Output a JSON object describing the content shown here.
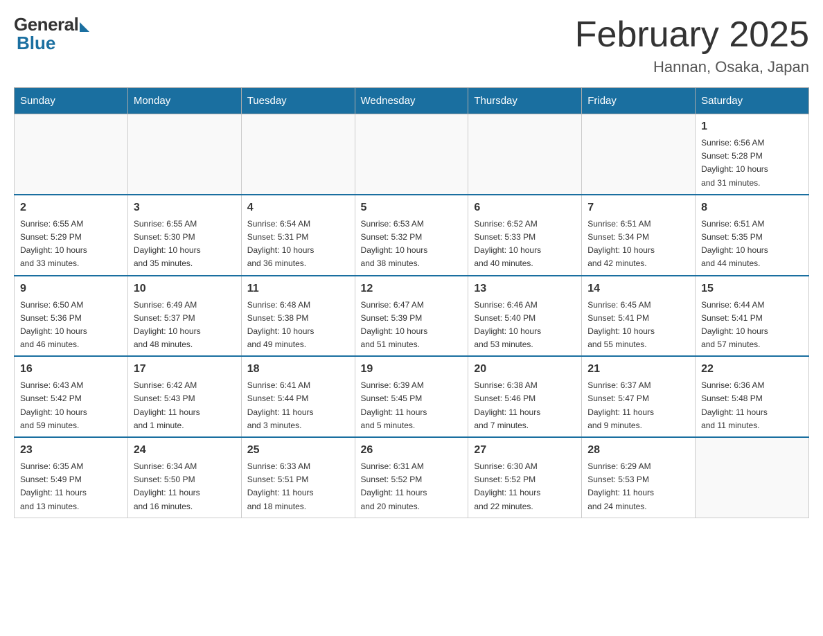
{
  "logo": {
    "general": "General",
    "blue": "Blue"
  },
  "title": {
    "month": "February 2025",
    "location": "Hannan, Osaka, Japan"
  },
  "weekdays": [
    "Sunday",
    "Monday",
    "Tuesday",
    "Wednesday",
    "Thursday",
    "Friday",
    "Saturday"
  ],
  "weeks": [
    [
      {
        "day": "",
        "info": ""
      },
      {
        "day": "",
        "info": ""
      },
      {
        "day": "",
        "info": ""
      },
      {
        "day": "",
        "info": ""
      },
      {
        "day": "",
        "info": ""
      },
      {
        "day": "",
        "info": ""
      },
      {
        "day": "1",
        "info": "Sunrise: 6:56 AM\nSunset: 5:28 PM\nDaylight: 10 hours\nand 31 minutes."
      }
    ],
    [
      {
        "day": "2",
        "info": "Sunrise: 6:55 AM\nSunset: 5:29 PM\nDaylight: 10 hours\nand 33 minutes."
      },
      {
        "day": "3",
        "info": "Sunrise: 6:55 AM\nSunset: 5:30 PM\nDaylight: 10 hours\nand 35 minutes."
      },
      {
        "day": "4",
        "info": "Sunrise: 6:54 AM\nSunset: 5:31 PM\nDaylight: 10 hours\nand 36 minutes."
      },
      {
        "day": "5",
        "info": "Sunrise: 6:53 AM\nSunset: 5:32 PM\nDaylight: 10 hours\nand 38 minutes."
      },
      {
        "day": "6",
        "info": "Sunrise: 6:52 AM\nSunset: 5:33 PM\nDaylight: 10 hours\nand 40 minutes."
      },
      {
        "day": "7",
        "info": "Sunrise: 6:51 AM\nSunset: 5:34 PM\nDaylight: 10 hours\nand 42 minutes."
      },
      {
        "day": "8",
        "info": "Sunrise: 6:51 AM\nSunset: 5:35 PM\nDaylight: 10 hours\nand 44 minutes."
      }
    ],
    [
      {
        "day": "9",
        "info": "Sunrise: 6:50 AM\nSunset: 5:36 PM\nDaylight: 10 hours\nand 46 minutes."
      },
      {
        "day": "10",
        "info": "Sunrise: 6:49 AM\nSunset: 5:37 PM\nDaylight: 10 hours\nand 48 minutes."
      },
      {
        "day": "11",
        "info": "Sunrise: 6:48 AM\nSunset: 5:38 PM\nDaylight: 10 hours\nand 49 minutes."
      },
      {
        "day": "12",
        "info": "Sunrise: 6:47 AM\nSunset: 5:39 PM\nDaylight: 10 hours\nand 51 minutes."
      },
      {
        "day": "13",
        "info": "Sunrise: 6:46 AM\nSunset: 5:40 PM\nDaylight: 10 hours\nand 53 minutes."
      },
      {
        "day": "14",
        "info": "Sunrise: 6:45 AM\nSunset: 5:41 PM\nDaylight: 10 hours\nand 55 minutes."
      },
      {
        "day": "15",
        "info": "Sunrise: 6:44 AM\nSunset: 5:41 PM\nDaylight: 10 hours\nand 57 minutes."
      }
    ],
    [
      {
        "day": "16",
        "info": "Sunrise: 6:43 AM\nSunset: 5:42 PM\nDaylight: 10 hours\nand 59 minutes."
      },
      {
        "day": "17",
        "info": "Sunrise: 6:42 AM\nSunset: 5:43 PM\nDaylight: 11 hours\nand 1 minute."
      },
      {
        "day": "18",
        "info": "Sunrise: 6:41 AM\nSunset: 5:44 PM\nDaylight: 11 hours\nand 3 minutes."
      },
      {
        "day": "19",
        "info": "Sunrise: 6:39 AM\nSunset: 5:45 PM\nDaylight: 11 hours\nand 5 minutes."
      },
      {
        "day": "20",
        "info": "Sunrise: 6:38 AM\nSunset: 5:46 PM\nDaylight: 11 hours\nand 7 minutes."
      },
      {
        "day": "21",
        "info": "Sunrise: 6:37 AM\nSunset: 5:47 PM\nDaylight: 11 hours\nand 9 minutes."
      },
      {
        "day": "22",
        "info": "Sunrise: 6:36 AM\nSunset: 5:48 PM\nDaylight: 11 hours\nand 11 minutes."
      }
    ],
    [
      {
        "day": "23",
        "info": "Sunrise: 6:35 AM\nSunset: 5:49 PM\nDaylight: 11 hours\nand 13 minutes."
      },
      {
        "day": "24",
        "info": "Sunrise: 6:34 AM\nSunset: 5:50 PM\nDaylight: 11 hours\nand 16 minutes."
      },
      {
        "day": "25",
        "info": "Sunrise: 6:33 AM\nSunset: 5:51 PM\nDaylight: 11 hours\nand 18 minutes."
      },
      {
        "day": "26",
        "info": "Sunrise: 6:31 AM\nSunset: 5:52 PM\nDaylight: 11 hours\nand 20 minutes."
      },
      {
        "day": "27",
        "info": "Sunrise: 6:30 AM\nSunset: 5:52 PM\nDaylight: 11 hours\nand 22 minutes."
      },
      {
        "day": "28",
        "info": "Sunrise: 6:29 AM\nSunset: 5:53 PM\nDaylight: 11 hours\nand 24 minutes."
      },
      {
        "day": "",
        "info": ""
      }
    ]
  ]
}
